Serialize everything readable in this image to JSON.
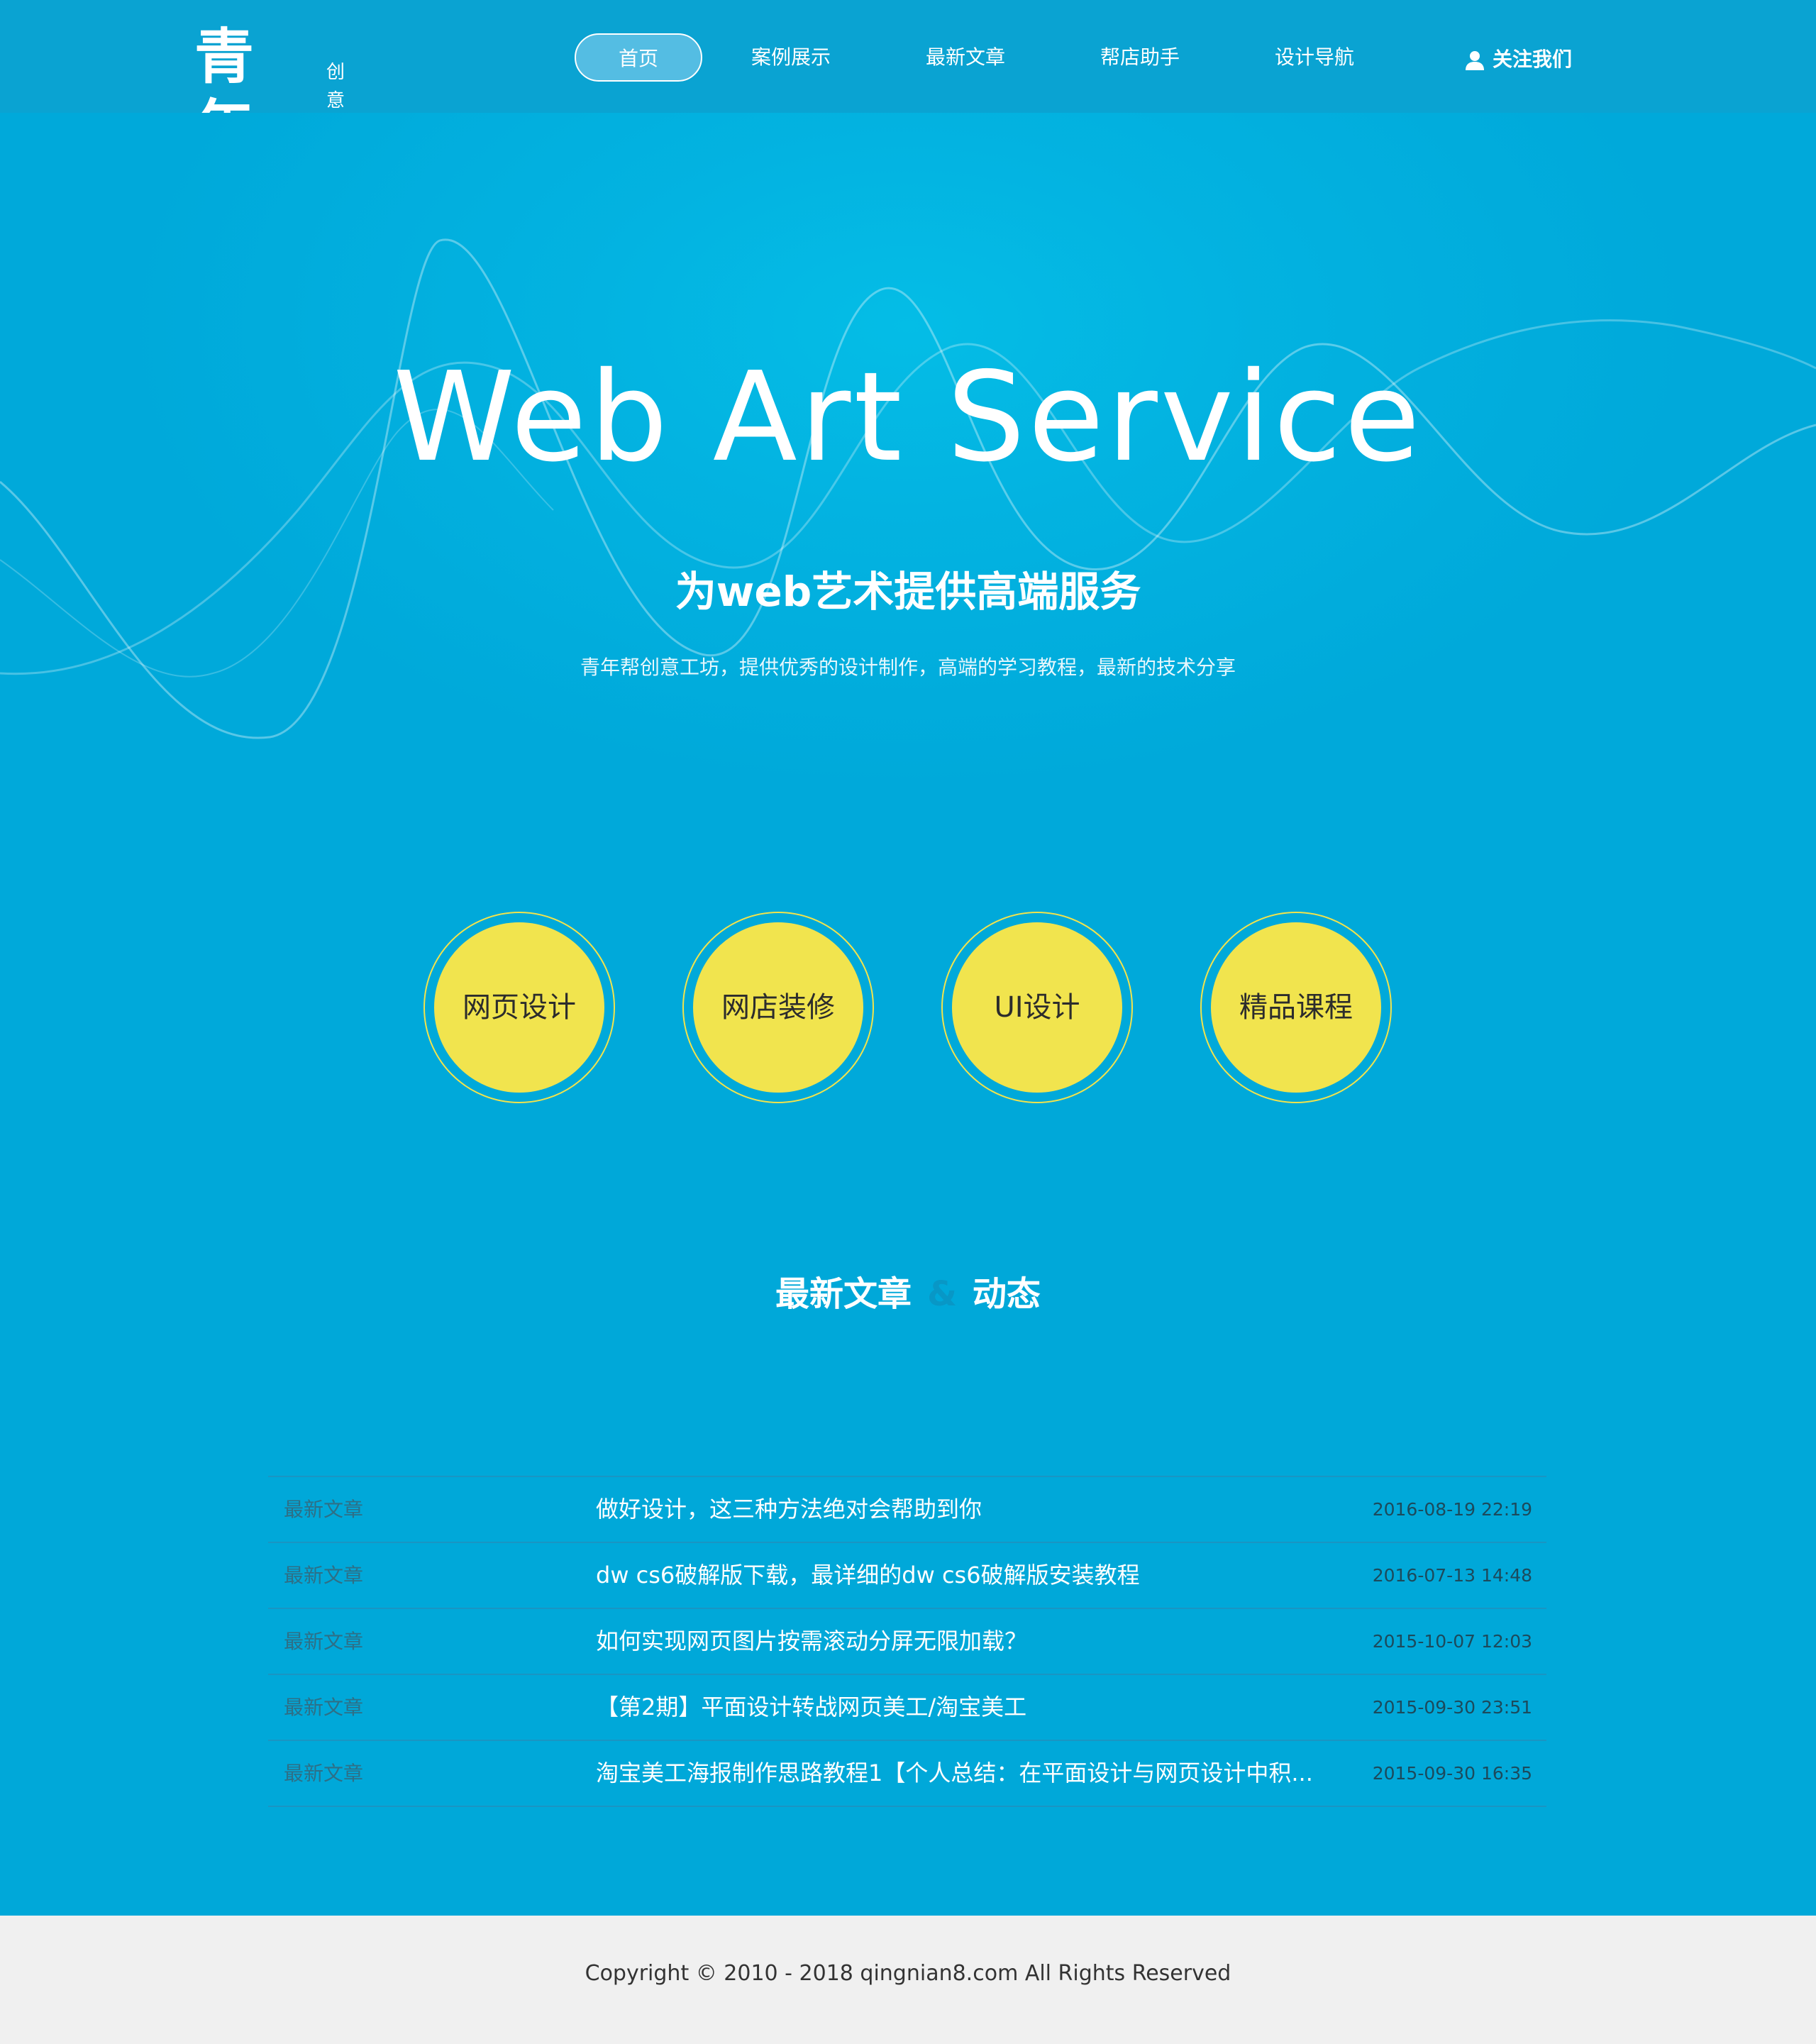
{
  "header": {
    "logo_main": "青年帮",
    "logo_sub": "创意工坊",
    "nav": [
      {
        "label": "首页",
        "active": true
      },
      {
        "label": "案例展示",
        "active": false
      },
      {
        "label": "最新文章",
        "active": false
      },
      {
        "label": "帮店助手",
        "active": false
      },
      {
        "label": "设计导航",
        "active": false
      }
    ],
    "follow_label": "关注我们",
    "follow_icon": "user-icon"
  },
  "hero": {
    "title": "Web Art Service",
    "subtitle": "为web艺术提供高端服务",
    "description": "青年帮创意工坊，提供优秀的设计制作，高端的学习教程，最新的技术分享"
  },
  "services": [
    {
      "label": "网页设计"
    },
    {
      "label": "网店装修"
    },
    {
      "label": "UI设计"
    },
    {
      "label": "精品课程"
    }
  ],
  "articles_section": {
    "title_left": "最新文章",
    "title_amp": "&",
    "title_right": "动态",
    "rows": [
      {
        "category": "最新文章",
        "title": "做好设计，这三种方法绝对会帮助到你",
        "date": "2016-08-19 22:19"
      },
      {
        "category": "最新文章",
        "title": "dw cs6破解版下载，最详细的dw cs6破解版安装教程",
        "date": "2016-07-13 14:48"
      },
      {
        "category": "最新文章",
        "title": "如何实现网页图片按需滚动分屏无限加载？",
        "date": "2015-10-07 12:03"
      },
      {
        "category": "最新文章",
        "title": "【第2期】平面设计转战网页美工/淘宝美工",
        "date": "2015-09-30 23:51"
      },
      {
        "category": "最新文章",
        "title": "淘宝美工海报制作思路教程1【个人总结：在平面设计与网页设计中积...",
        "date": "2015-09-30 16:35"
      }
    ]
  },
  "footer": {
    "copyright": "Copyright © 2010 - 2018 qingnian8.com All Rights Reserved"
  },
  "colors": {
    "background": "#00a8d9",
    "header": "#0aa3d2",
    "accent_yellow": "#f1e44e",
    "footer": "#f0f0f0"
  }
}
